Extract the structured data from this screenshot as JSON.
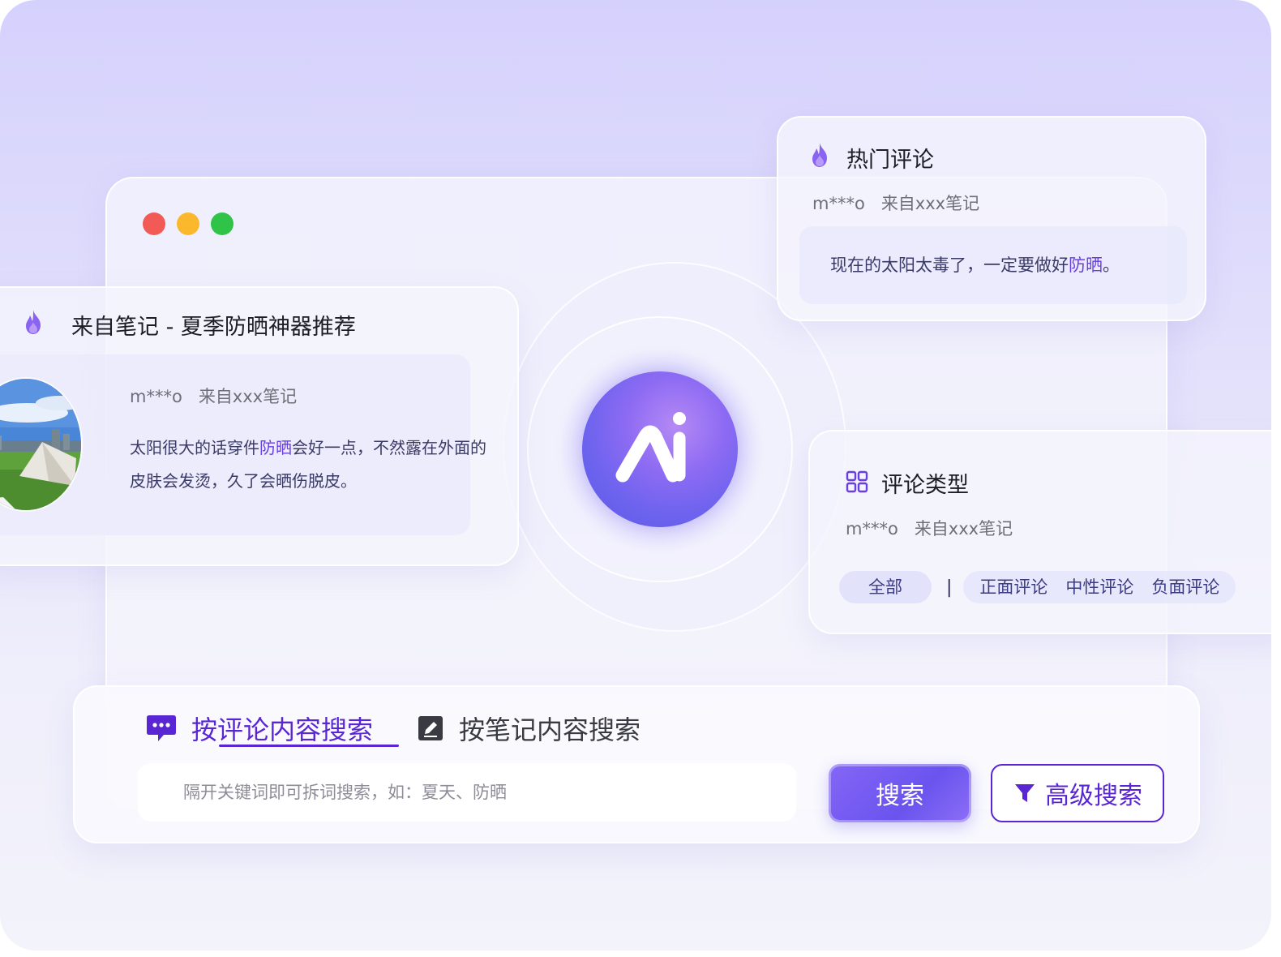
{
  "note_card": {
    "title": "来自笔记 - 夏季防晒神器推荐",
    "icon": "flame-icon",
    "user": "m***o",
    "source": "来自xxx笔记",
    "text_before": "太阳很大的话穿件",
    "keyword": "防晒",
    "text_after": "会好一点，不然露在外面的皮肤会发烫，久了会晒伤脱皮。"
  },
  "hot_card": {
    "title": "热门评论",
    "icon": "flame-icon",
    "user": "m***o",
    "source": "来自xxx笔记",
    "text_before": "现在的太阳太毒了，一定要做好",
    "keyword": "防晒",
    "text_after": "。"
  },
  "type_card": {
    "title": "评论类型",
    "icon": "grid-icon",
    "user": "m***o",
    "source": "来自xxx笔记",
    "chip_all": "全部",
    "separator": "|",
    "chips": [
      "正面评论",
      "中性评论",
      "负面评论"
    ]
  },
  "center": {
    "logo_text": "Ai"
  },
  "search": {
    "tab_comment": "按评论内容搜索",
    "tab_note": "按笔记内容搜索",
    "placeholder": "隔开关键词即可拆词搜索，如：夏天、防晒",
    "button": "搜索",
    "advanced": "高级搜索"
  },
  "colors": {
    "accent": "#5a26d3",
    "highlight": "#6a3fe0",
    "background_top": "#d5d1fd"
  }
}
